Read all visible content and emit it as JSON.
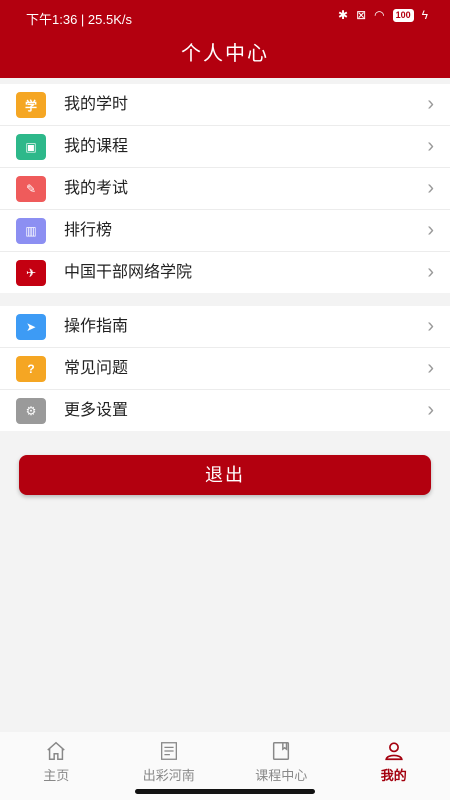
{
  "status_bar": {
    "left_text": "下午1:36 | 25.5K/s",
    "battery": "100"
  },
  "header": {
    "title": "个人中心"
  },
  "menu_group_1": [
    {
      "label": "我的学时",
      "icon": "study-hours-icon",
      "color": "#f5a623",
      "glyph": "学"
    },
    {
      "label": "我的课程",
      "icon": "courses-icon",
      "color": "#2db88a",
      "glyph": "▣"
    },
    {
      "label": "我的考试",
      "icon": "exam-icon",
      "color": "#ef5b5b",
      "glyph": "✎"
    },
    {
      "label": "排行榜",
      "icon": "ranking-icon",
      "color": "#8c8ff2",
      "glyph": "▥"
    },
    {
      "label": "中国干部网络学院",
      "icon": "college-logo-icon",
      "color": "#c40011",
      "glyph": "✈"
    }
  ],
  "menu_group_2": [
    {
      "label": "操作指南",
      "icon": "guide-icon",
      "color": "#3d9bf5",
      "glyph": "➤"
    },
    {
      "label": "常见问题",
      "icon": "faq-icon",
      "color": "#f5a623",
      "glyph": "?"
    },
    {
      "label": "更多设置",
      "icon": "settings-icon",
      "color": "#9a9a9a",
      "glyph": "⚙"
    }
  ],
  "logout": {
    "label": "退出"
  },
  "bottom_nav": [
    {
      "label": "主页",
      "icon": "home-icon",
      "active": false
    },
    {
      "label": "出彩河南",
      "icon": "henan-icon",
      "active": false
    },
    {
      "label": "课程中心",
      "icon": "course-center-icon",
      "active": false
    },
    {
      "label": "我的",
      "icon": "profile-icon",
      "active": true
    }
  ],
  "colors": {
    "brand": "#b3000f",
    "active_nav": "#a3000e"
  }
}
